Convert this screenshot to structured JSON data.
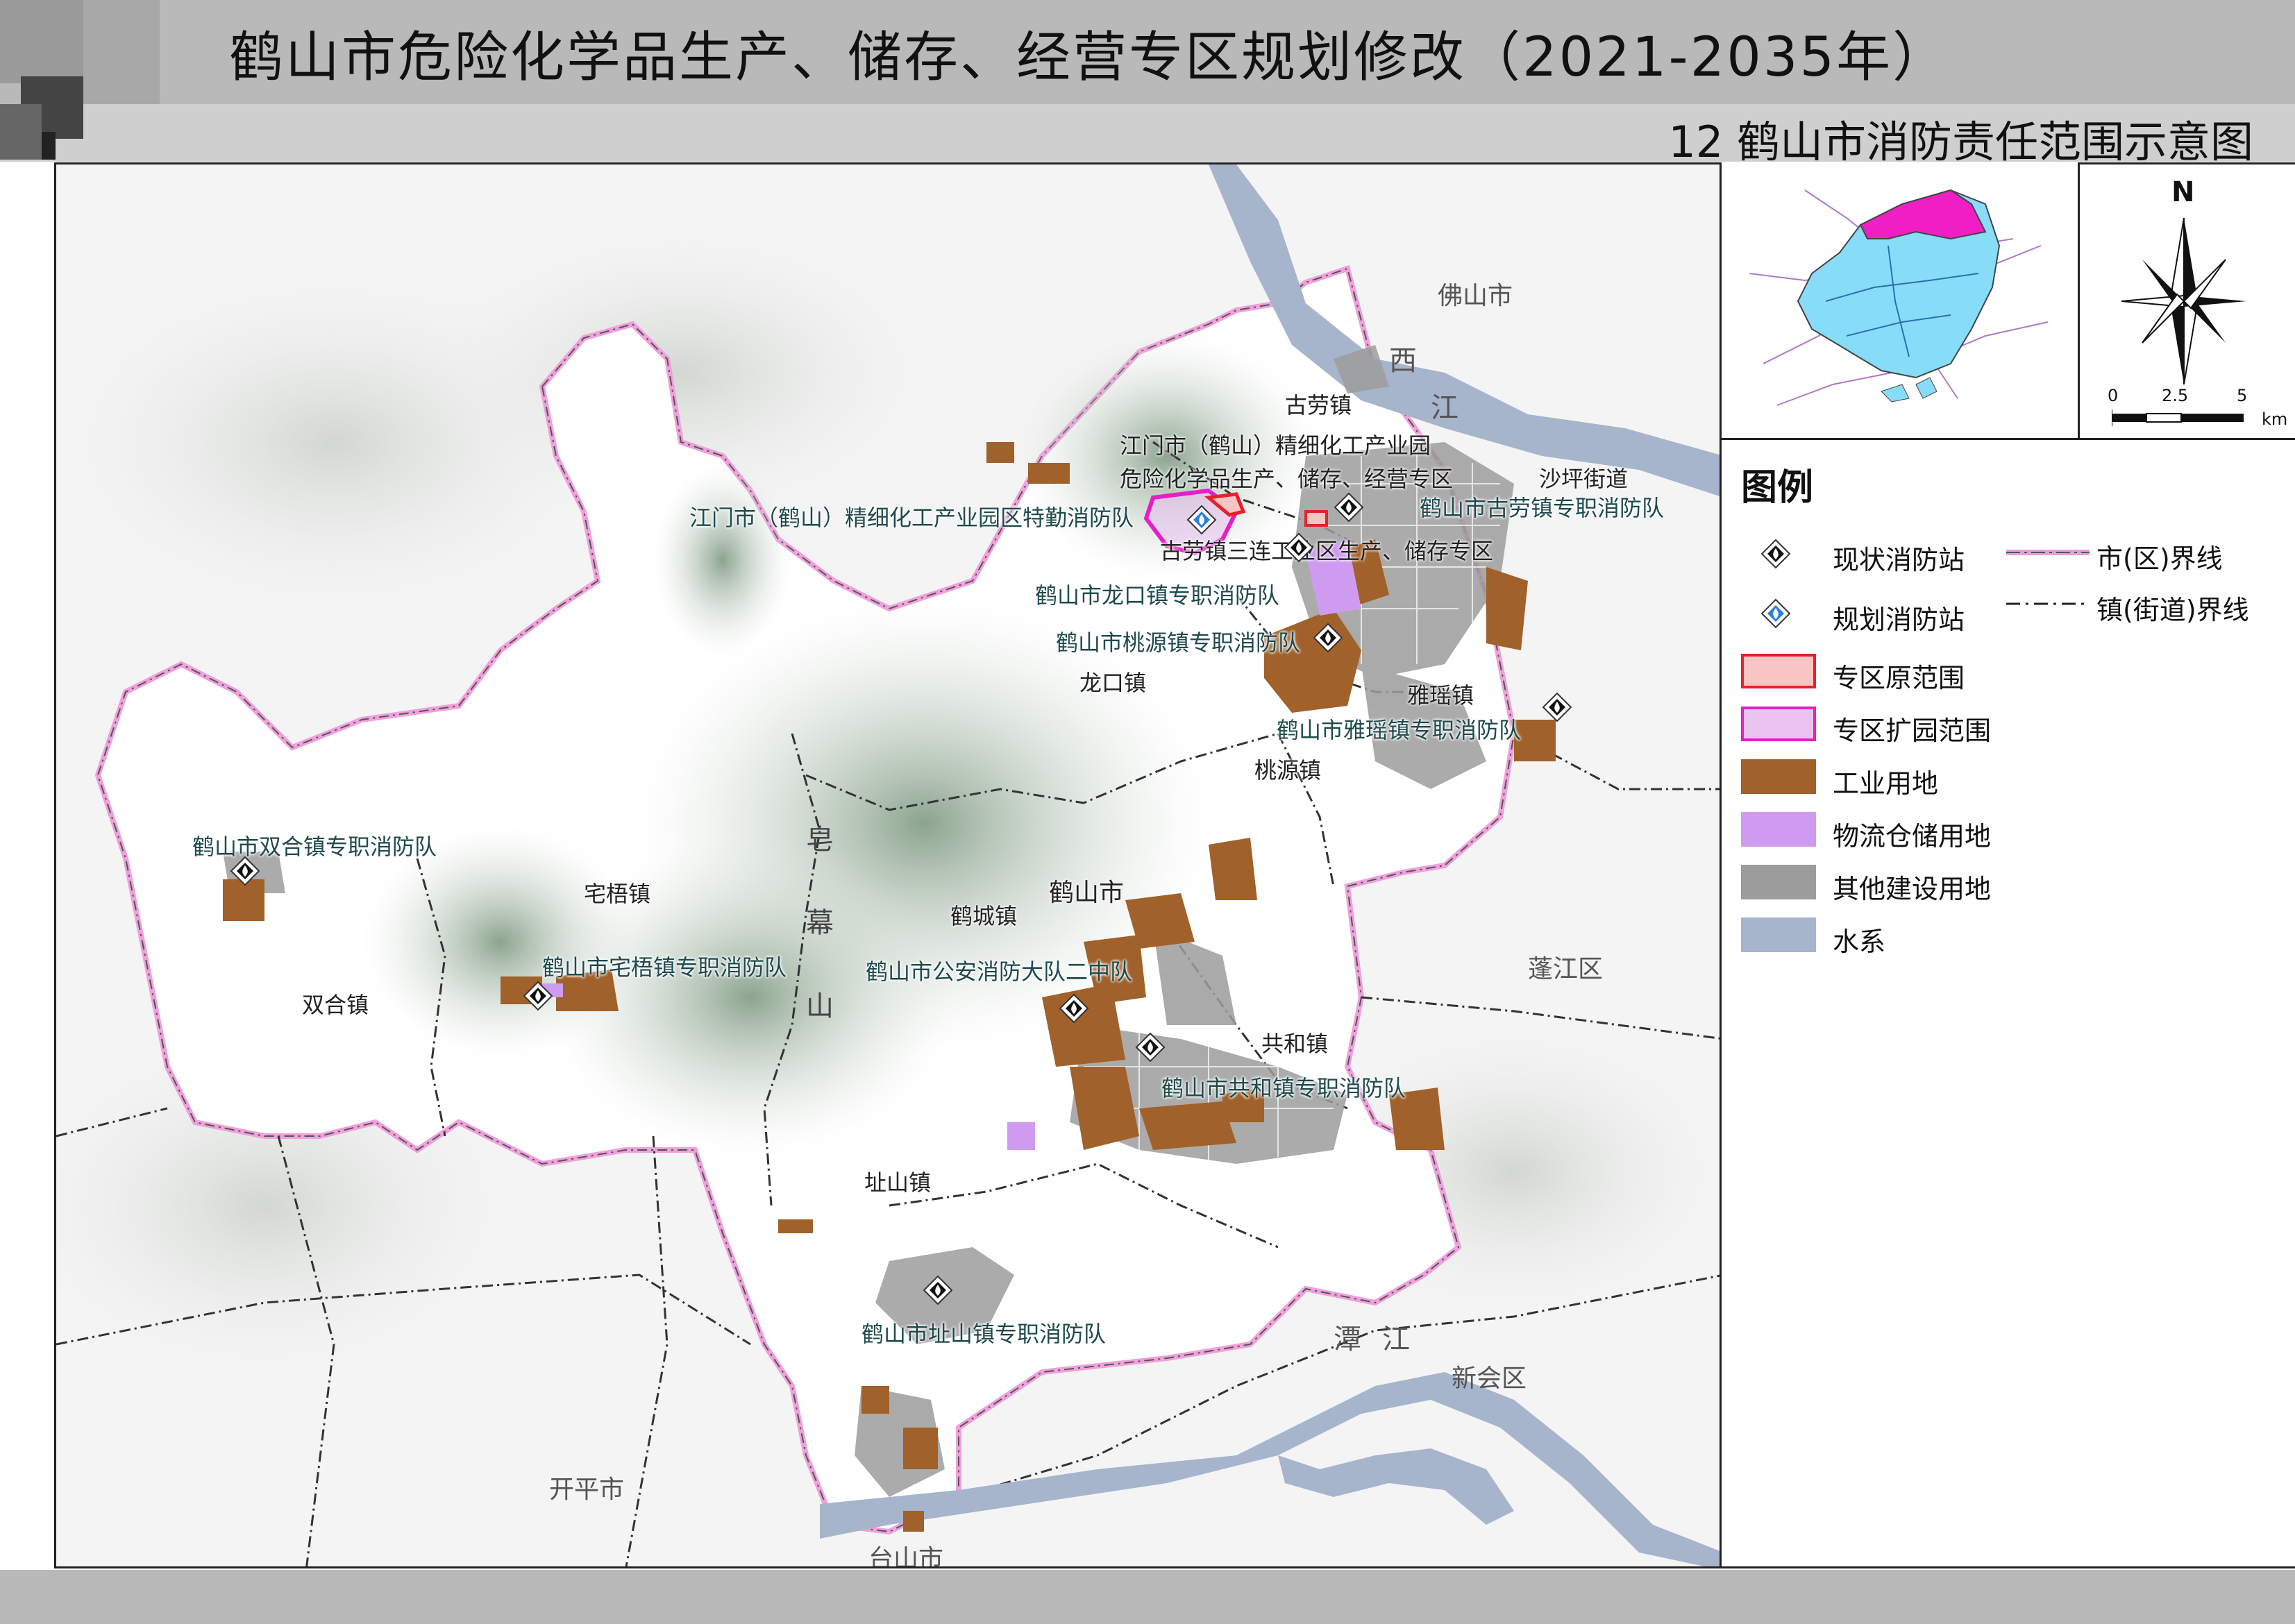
{
  "header": {
    "title": "鹤山市危险化学品生产、储存、经营专区规划修改（2021-2035年）",
    "subtitle": "12 鹤山市消防责任范围示意图"
  },
  "map": {
    "regions": [
      "佛山市",
      "蓬江区",
      "新会区",
      "开平市",
      "台山市"
    ],
    "rivers": [
      "西",
      "江",
      "潭",
      "江"
    ],
    "mountain": [
      "皂",
      "幕",
      "山"
    ],
    "city": "鹤山市",
    "towns": [
      "古劳镇",
      "沙坪街道",
      "龙口镇",
      "雅瑶镇",
      "桃源镇",
      "宅梧镇",
      "双合镇",
      "鹤城镇",
      "共和镇",
      "址山镇"
    ],
    "zones": [
      "江门市（鹤山）精细化工产业园",
      "危险化学品生产、储存、经营专区",
      "古劳镇三连工业区生产、储存专区"
    ],
    "stations": {
      "planned": "江门市（鹤山）精细化工产业园区特勤消防队",
      "gulao": "鹤山市古劳镇专职消防队",
      "longkou": "鹤山市龙口镇专职消防队",
      "taoyuan": "鹤山市桃源镇专职消防队",
      "yayao": "鹤山市雅瑶镇专职消防队",
      "shuanghe": "鹤山市双合镇专职消防队",
      "zhaiwu": "鹤山市宅梧镇专职消防队",
      "police": "鹤山市公安消防大队二中队",
      "gonghe": "鹤山市共和镇专职消防队",
      "zhishan": "鹤山市址山镇专职消防队"
    }
  },
  "compass": {
    "north": "N",
    "scale_ticks": [
      "0",
      "2.5",
      "5"
    ],
    "scale_unit": "km"
  },
  "legend": {
    "title": "图例",
    "items": [
      {
        "label": "现状消防站",
        "icon": "existing-fire-station-icon"
      },
      {
        "label": "规划消防站",
        "icon": "planned-fire-station-icon"
      },
      {
        "label": "专区原范围",
        "color": "#f9c4c4",
        "border": "#e8202a"
      },
      {
        "label": "专区扩园范围",
        "color": "#eac3f0",
        "border": "#e51fc6"
      },
      {
        "label": "工业用地",
        "color": "#a0612a"
      },
      {
        "label": "物流仓储用地",
        "color": "#cf9bf0"
      },
      {
        "label": "其他建设用地",
        "color": "#9c9c9c"
      },
      {
        "label": "水系",
        "color": "#a6b4cc"
      }
    ],
    "lines": [
      {
        "label": "市(区)界线",
        "color": "#e69fd6"
      },
      {
        "label": "镇(街道)界线",
        "color": "#222222"
      }
    ]
  },
  "colors": {
    "header_band": "#b9b9b9",
    "boundary_pink": "#f0a0dc",
    "terrain_green": "#8fa68f",
    "water": "#a6b4cc",
    "industrial": "#a0612a",
    "logistics": "#cf9bf0",
    "built": "#9c9c9c",
    "inset_county": "#87dcf7",
    "inset_zone": "#f01fc5"
  }
}
